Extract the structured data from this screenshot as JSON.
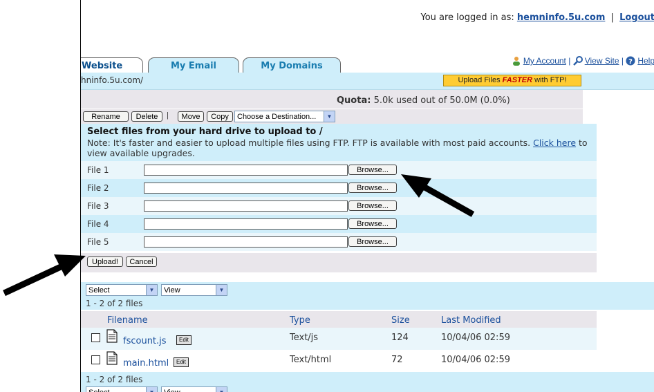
{
  "header": {
    "logged_in_prefix": "You are logged in as:",
    "username": "hemninfo.5u.com",
    "separator": "|",
    "logout": "Logout"
  },
  "tabs": [
    {
      "label": "Website",
      "active": true
    },
    {
      "label": "My Email",
      "active": false
    },
    {
      "label": "My Domains",
      "active": false
    }
  ],
  "top_links": {
    "my_account": "My Account",
    "view_site": "View Site",
    "help": "Help",
    "divider": "|"
  },
  "path": {
    "current": "hninfo.5u.com/",
    "ftp_button_pre": "Upload Files ",
    "ftp_button_em": "FASTER",
    "ftp_button_post": " with FTP!"
  },
  "quota": {
    "label": "Quota:",
    "value": "5.0k used out of 50.0M (0.0%)"
  },
  "actions": {
    "rename": "Rename",
    "delete": "Delete",
    "divider": "|",
    "move": "Move",
    "copy": "Copy",
    "destination_select": "Choose a Destination..."
  },
  "upload": {
    "heading": "Select files from your hard drive to upload to /",
    "note_pre": "Note: It's faster and easier to upload multiple files using FTP. FTP is available with most paid accounts. ",
    "note_link": "Click here",
    "note_post": " to view available upgrades.",
    "files": [
      "File 1",
      "File 2",
      "File 3",
      "File 4",
      "File 5"
    ],
    "browse_label": "Browse...",
    "upload_button": "Upload!",
    "cancel_button": "Cancel"
  },
  "list": {
    "select_label": "Select",
    "view_label": "View",
    "count_text": "1 - 2 of 2 files",
    "columns": [
      "Filename",
      "Type",
      "Size",
      "Last Modified"
    ],
    "edit_label": "Edit",
    "rows": [
      {
        "name": "fscount.js",
        "type": "Text/js",
        "size": "124",
        "modified": "10/04/06 02:59"
      },
      {
        "name": "main.html",
        "type": "Text/html",
        "size": "72",
        "modified": "10/04/06 02:59"
      }
    ],
    "footer_count": "1 - 2 of 2 files"
  },
  "colors": {
    "light_blue": "#cfeefa",
    "gray_band": "#e9e6eb",
    "link_blue": "#1a4f9c",
    "ftp_yellow": "#ffcc33",
    "faster_red": "#c00000"
  }
}
